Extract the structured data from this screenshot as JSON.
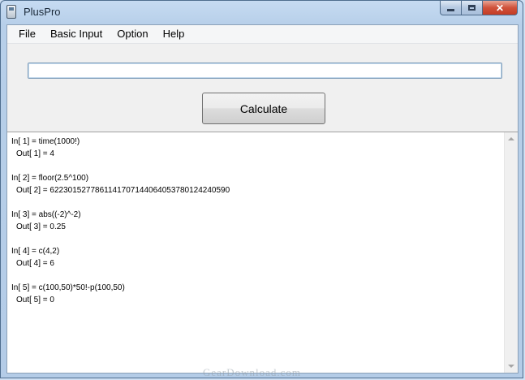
{
  "window": {
    "title": "PlusPro"
  },
  "menu": [
    "File",
    "Basic Input",
    "Option",
    "Help"
  ],
  "input": {
    "value": "",
    "placeholder": ""
  },
  "calculate_label": "Calculate",
  "output_lines": [
    "In[ 1] = time(1000!)",
    "Out[ 1] = 4",
    "",
    "In[ 2] = floor(2.5^100)",
    "Out[ 2] = 6223015277861141707144064053780124240590",
    "",
    "In[ 3] = abs((-2)^-2)",
    "Out[ 3] = 0.25",
    "",
    "In[ 4] = c(4,2)",
    "Out[ 4] = 6",
    "",
    "In[ 5] = c(100,50)*50!-p(100,50)",
    "Out[ 5] = 0"
  ],
  "watermark": "GearDownload.com"
}
